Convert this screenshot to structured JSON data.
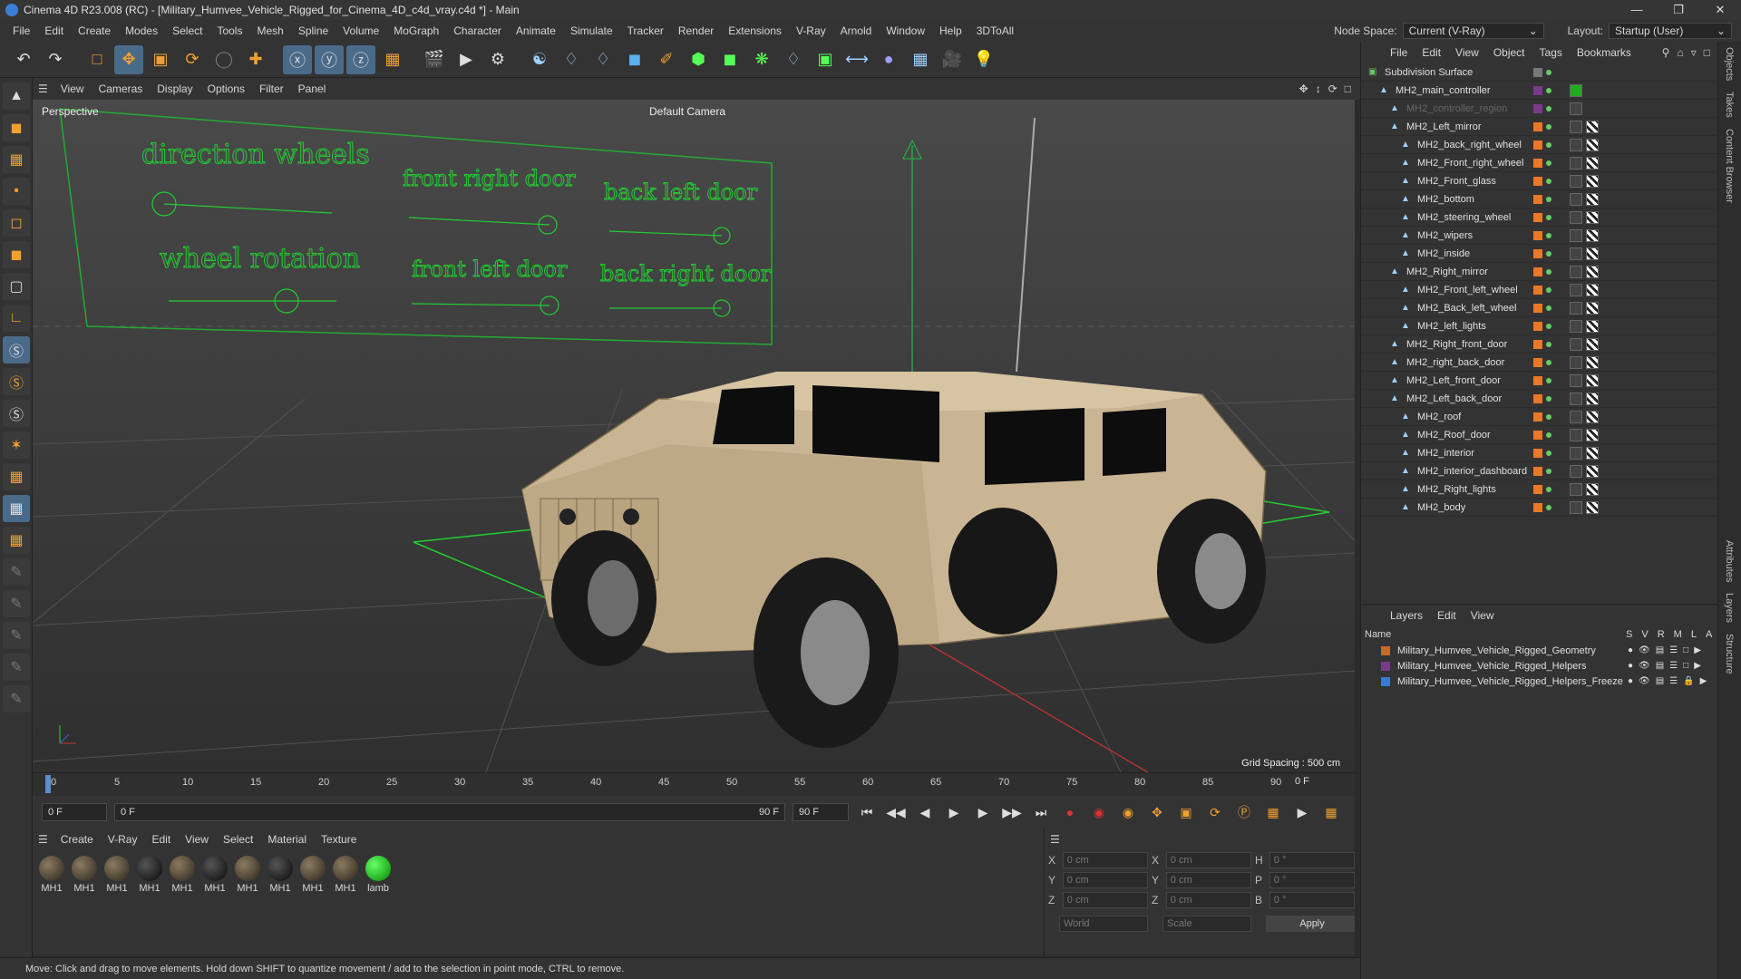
{
  "titlebar": {
    "title": "Cinema 4D R23.008 (RC) - [Military_Humvee_Vehicle_Rigged_for_Cinema_4D_c4d_vray.c4d *] - Main"
  },
  "menubar": {
    "items": [
      "File",
      "Edit",
      "Create",
      "Modes",
      "Select",
      "Tools",
      "Mesh",
      "Spline",
      "Volume",
      "MoGraph",
      "Character",
      "Animate",
      "Simulate",
      "Tracker",
      "Render",
      "Extensions",
      "V-Ray",
      "Arnold",
      "Window",
      "Help",
      "3DToAll"
    ],
    "node_space_label": "Node Space:",
    "node_space_value": "Current (V-Ray)",
    "layout_label": "Layout:",
    "layout_value": "Startup (User)"
  },
  "viewport": {
    "menu": [
      "View",
      "Cameras",
      "Display",
      "Options",
      "Filter",
      "Panel"
    ],
    "label": "Perspective",
    "camera": "Default Camera",
    "grid_spacing": "Grid Spacing : 500 cm",
    "rig_labels": [
      "direction wheels",
      "front right door",
      "back left door",
      "wheel rotation",
      "front left door",
      "back right door"
    ]
  },
  "timeline": {
    "ticks": [
      "0",
      "5",
      "10",
      "15",
      "20",
      "25",
      "30",
      "35",
      "40",
      "45",
      "50",
      "55",
      "60",
      "65",
      "70",
      "75",
      "80",
      "85",
      "90"
    ],
    "current_frame": "0 F"
  },
  "transport": {
    "start": "0 F",
    "current": "0 F",
    "end1": "90 F",
    "end2": "90 F"
  },
  "materials": {
    "menu": [
      "Create",
      "V-Ray",
      "Edit",
      "View",
      "Select",
      "Material",
      "Texture"
    ],
    "items": [
      {
        "label": "MH1",
        "kind": "tan"
      },
      {
        "label": "MH1",
        "kind": "tan"
      },
      {
        "label": "MH1",
        "kind": "tan"
      },
      {
        "label": "MH1",
        "kind": "dark"
      },
      {
        "label": "MH1",
        "kind": "tan"
      },
      {
        "label": "MH1",
        "kind": "dark"
      },
      {
        "label": "MH1",
        "kind": "tan"
      },
      {
        "label": "MH1",
        "kind": "dark"
      },
      {
        "label": "MH1",
        "kind": "tan"
      },
      {
        "label": "MH1",
        "kind": "tan"
      },
      {
        "label": "lamb",
        "kind": "green"
      }
    ]
  },
  "coords": {
    "rows": [
      {
        "a": "X",
        "v1": "0 cm",
        "b": "X",
        "v2": "0 cm",
        "c": "H",
        "v3": "0 °"
      },
      {
        "a": "Y",
        "v1": "0 cm",
        "b": "Y",
        "v2": "0 cm",
        "c": "P",
        "v3": "0 °"
      },
      {
        "a": "Z",
        "v1": "0 cm",
        "b": "Z",
        "v2": "0 cm",
        "c": "B",
        "v3": "0 °"
      }
    ],
    "world": "World",
    "scale": "Scale",
    "apply": "Apply"
  },
  "status": "Move: Click and drag to move elements. Hold down SHIFT to quantize movement / add to the selection in point mode, CTRL to remove.",
  "objects": {
    "menu": [
      "File",
      "Edit",
      "View",
      "Object",
      "Tags",
      "Bookmarks"
    ],
    "items": [
      {
        "name": "Subdivision Surface",
        "indent": 0
      },
      {
        "name": "MH2_main_controller",
        "indent": 1
      },
      {
        "name": "MH2_controller_region",
        "indent": 2
      },
      {
        "name": "MH2_Left_mirror",
        "indent": 2
      },
      {
        "name": "MH2_back_right_wheel",
        "indent": 3
      },
      {
        "name": "MH2_Front_right_wheel",
        "indent": 3
      },
      {
        "name": "MH2_Front_glass",
        "indent": 3
      },
      {
        "name": "MH2_bottom",
        "indent": 3
      },
      {
        "name": "MH2_steering_wheel",
        "indent": 3
      },
      {
        "name": "MH2_wipers",
        "indent": 3
      },
      {
        "name": "MH2_inside",
        "indent": 3
      },
      {
        "name": "MH2_Right_mirror",
        "indent": 2
      },
      {
        "name": "MH2_Front_left_wheel",
        "indent": 3
      },
      {
        "name": "MH2_Back_left_wheel",
        "indent": 3
      },
      {
        "name": "MH2_left_lights",
        "indent": 3
      },
      {
        "name": "MH2_Right_front_door",
        "indent": 2
      },
      {
        "name": "MH2_right_back_door",
        "indent": 2
      },
      {
        "name": "MH2_Left_front_door",
        "indent": 2
      },
      {
        "name": "MH2_Left_back_door",
        "indent": 2
      },
      {
        "name": "MH2_roof",
        "indent": 3
      },
      {
        "name": "MH2_Roof_door",
        "indent": 3
      },
      {
        "name": "MH2_interior",
        "indent": 3
      },
      {
        "name": "MH2_interior_dashboard",
        "indent": 3
      },
      {
        "name": "MH2_Right_lights",
        "indent": 3
      },
      {
        "name": "MH2_body",
        "indent": 3
      }
    ]
  },
  "layers": {
    "menu": [
      "Layers",
      "Edit",
      "View"
    ],
    "name_header": "Name",
    "cols": [
      "S",
      "V",
      "R",
      "M",
      "L",
      "A"
    ],
    "items": [
      {
        "name": "Military_Humvee_Vehicle_Rigged_Geometry",
        "color": "#c86a2a"
      },
      {
        "name": "Military_Humvee_Vehicle_Rigged_Helpers",
        "color": "#7a3a8a"
      },
      {
        "name": "Military_Humvee_Vehicle_Rigged_Helpers_Freeze",
        "color": "#3a7ad0"
      }
    ]
  },
  "sidetabs": [
    "Objects",
    "Takes",
    "Content Browser",
    "Attributes",
    "Layers",
    "Structure"
  ]
}
